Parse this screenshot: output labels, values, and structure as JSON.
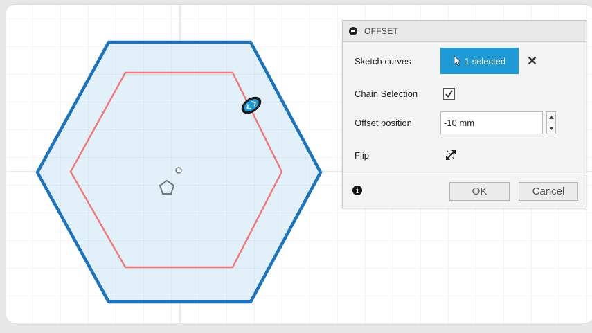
{
  "panel": {
    "title": "OFFSET",
    "rows": {
      "sketch_curves": {
        "label": "Sketch curves",
        "value": "1 selected"
      },
      "chain_selection": {
        "label": "Chain Selection",
        "checked": true
      },
      "offset_position": {
        "label": "Offset position",
        "value": "-10 mm"
      },
      "flip": {
        "label": "Flip"
      }
    },
    "buttons": {
      "ok": "OK",
      "cancel": "Cancel"
    }
  },
  "icons": [
    "collapse-icon",
    "cursor-icon",
    "close-icon",
    "checkmark-icon",
    "spinner-up-icon",
    "spinner-down-icon",
    "flip-icon",
    "info-icon",
    "sketch-center-icon",
    "offset-manipulator-icon"
  ],
  "colors": {
    "outer_hexagon": "#1e73be",
    "inner_hexagon": "#f07a7a",
    "selection_blue": "#1e9ad6",
    "fill": "#e2f0fa"
  }
}
